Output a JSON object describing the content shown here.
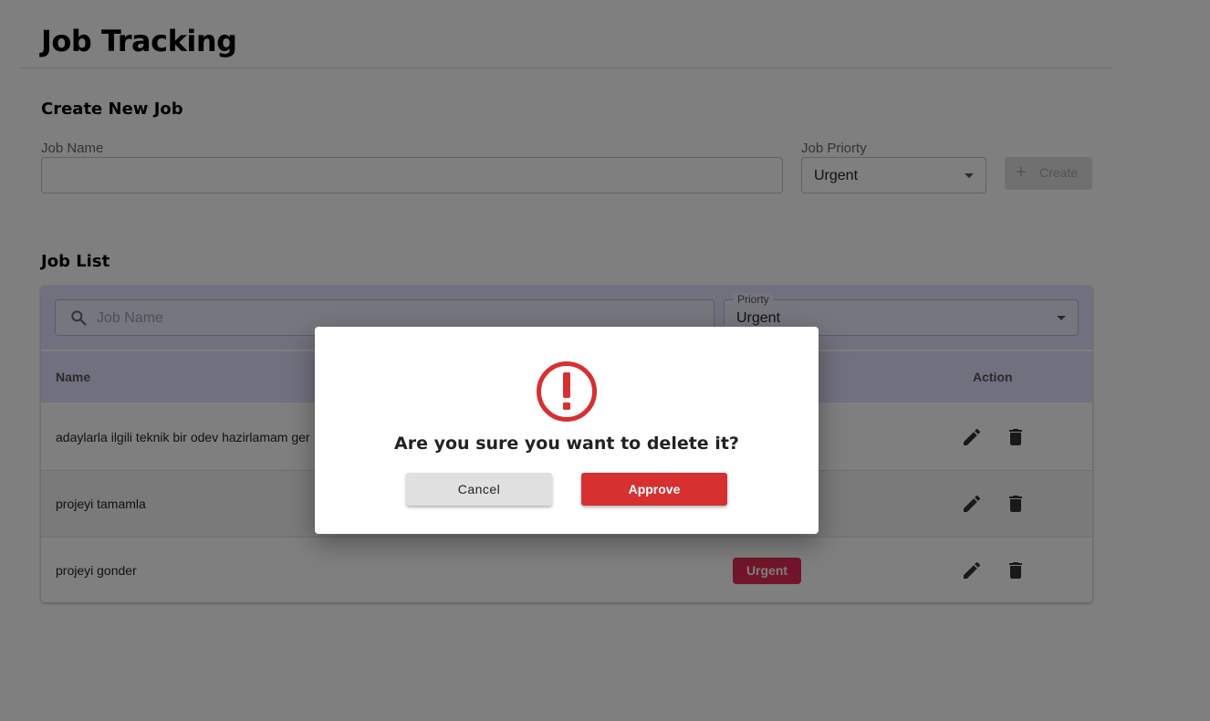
{
  "header": {
    "title": "Job Tracking"
  },
  "create_section": {
    "title": "Create New Job",
    "job_name_label": "Job Name",
    "job_name_value": "",
    "priority_label": "Job Priorty",
    "priority_value": "Urgent",
    "create_button_label": "Create"
  },
  "job_list": {
    "title": "Job List",
    "search_placeholder": "Job Name",
    "priority_filter_label": "Priorty",
    "priority_filter_value": "Urgent",
    "columns": {
      "name": "Name",
      "action": "Action"
    },
    "rows": [
      {
        "name": "adaylarla ilgili teknik bir odev hazirlamam ger",
        "priority": ""
      },
      {
        "name": "projeyi tamamla",
        "priority": ""
      },
      {
        "name": "projeyi gonder",
        "priority": "Urgent"
      }
    ]
  },
  "dialog": {
    "icon": "alert-circle-icon",
    "message": "Are you sure you want to delete it?",
    "cancel_label": "Cancel",
    "approve_label": "Approve"
  },
  "colors": {
    "accent_header": "#e2e1fc",
    "urgent_badge": "#e52b55",
    "danger": "#d63031"
  }
}
